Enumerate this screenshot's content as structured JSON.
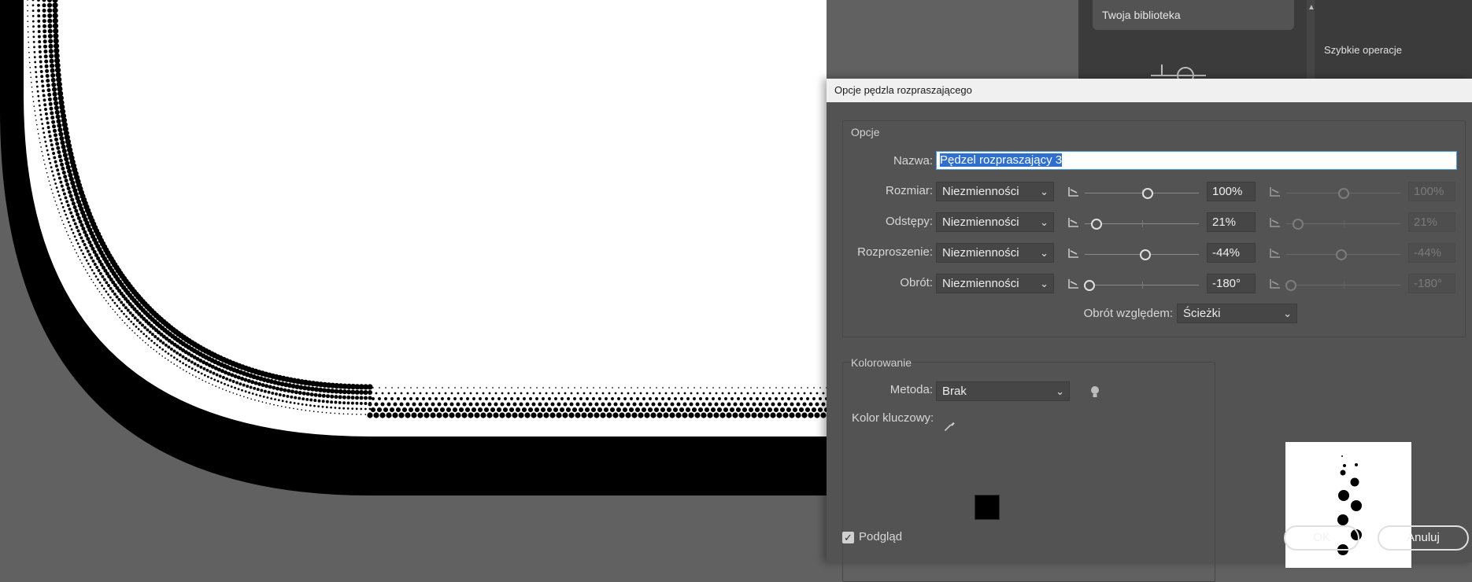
{
  "right_panel": {
    "library_label": "Twoja biblioteka",
    "quick_actions_label": "Szybkie operacje"
  },
  "dialog": {
    "title": "Opcje pędzla rozpraszającego",
    "options_group": "Opcje",
    "name_label": "Nazwa:",
    "name_value": "Pędzel rozpraszający 3",
    "rows": [
      {
        "label": "Rozmiar:",
        "mode": "Niezmienności",
        "value": "100%",
        "value2": "100%",
        "knob": 0.55,
        "knob2": 0.5
      },
      {
        "label": "Odstępy:",
        "mode": "Niezmienności",
        "value": "21%",
        "value2": "21%",
        "knob": 0.1,
        "knob2": 0.1
      },
      {
        "label": "Rozproszenie:",
        "mode": "Niezmienności",
        "value": "-44%",
        "value2": "-44%",
        "knob": 0.53,
        "knob2": 0.48
      },
      {
        "label": "Obrót:",
        "mode": "Niezmienności",
        "value": "-180°",
        "value2": "-180°",
        "knob": 0.04,
        "knob2": 0.04
      }
    ],
    "rotation_relative_label": "Obrót względem:",
    "rotation_relative_value": "Ścieżki",
    "coloring_group": "Kolorowanie",
    "method_label": "Metoda:",
    "method_value": "Brak",
    "key_color_label": "Kolor kluczowy:",
    "key_color": "#000000",
    "preview_label": "Podgląd",
    "preview_checked": true,
    "ok_label": "OK",
    "cancel_label": "Anuluj"
  },
  "colors": {
    "canvas_bg": "#616161",
    "dialog_bg": "#535353",
    "selection": "#2f6fcf"
  }
}
